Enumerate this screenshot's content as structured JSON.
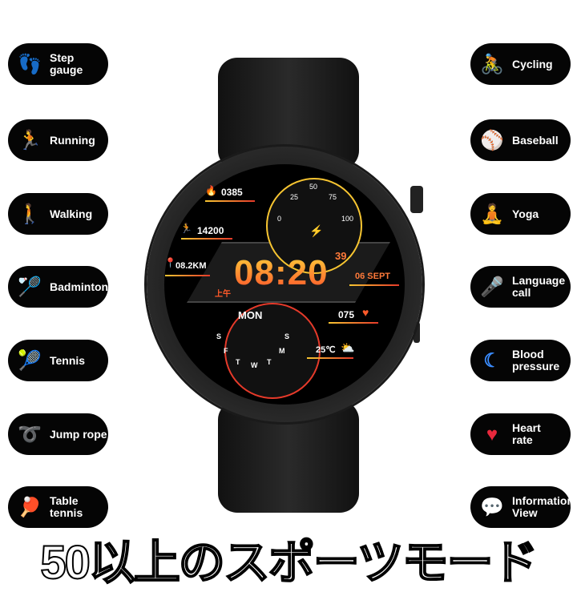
{
  "left_features": [
    {
      "label": "Step\ngauge",
      "icon": "footsteps-icon",
      "color": "#f7941d"
    },
    {
      "label": "Running",
      "icon": "running-icon",
      "color": "#1ec8e8"
    },
    {
      "label": "Walking",
      "icon": "walking-icon",
      "color": "#f7941d"
    },
    {
      "label": "Badminton",
      "icon": "badminton-icon",
      "color": "#1ec8e8"
    },
    {
      "label": "Tennis",
      "icon": "tennis-icon",
      "color": "#f7941d"
    },
    {
      "label": "Jump rope",
      "icon": "jump-rope-icon",
      "color": "#f7941d"
    },
    {
      "label": "Table\ntennis",
      "icon": "table-tennis-icon",
      "color": "#1ec8e8"
    }
  ],
  "right_features": [
    {
      "label": "Cycling",
      "icon": "cycling-icon",
      "color": "#3ddc5a"
    },
    {
      "label": "Baseball",
      "icon": "baseball-icon",
      "color": "#1ec8e8"
    },
    {
      "label": "Yoga",
      "icon": "yoga-icon",
      "color": "#f7941d"
    },
    {
      "label": "Language\ncall",
      "icon": "microphone-icon",
      "color": "#f06a8a"
    },
    {
      "label": "Blood\npressure",
      "icon": "moon-icon",
      "color": "#3a8cff"
    },
    {
      "label": "Heart\nrate",
      "icon": "heart-icon",
      "color": "#e8283c"
    },
    {
      "label": "Information\nView",
      "icon": "chat-icon",
      "color": "#3ddc5a"
    }
  ],
  "watch": {
    "calories": "0385",
    "steps": "14200",
    "distance": "08.2KM",
    "time": "08:20",
    "seconds": "39",
    "ampm": "上午",
    "date": "06 SEPT",
    "heart_rate": "075",
    "temperature": "25℃",
    "day": "MON",
    "battery_ticks": [
      "0",
      "25",
      "50",
      "75",
      "100"
    ],
    "week_letters": [
      "S",
      "F",
      "T",
      "W",
      "T",
      "M",
      "S"
    ]
  },
  "headline": "50以上のスポーツモード"
}
